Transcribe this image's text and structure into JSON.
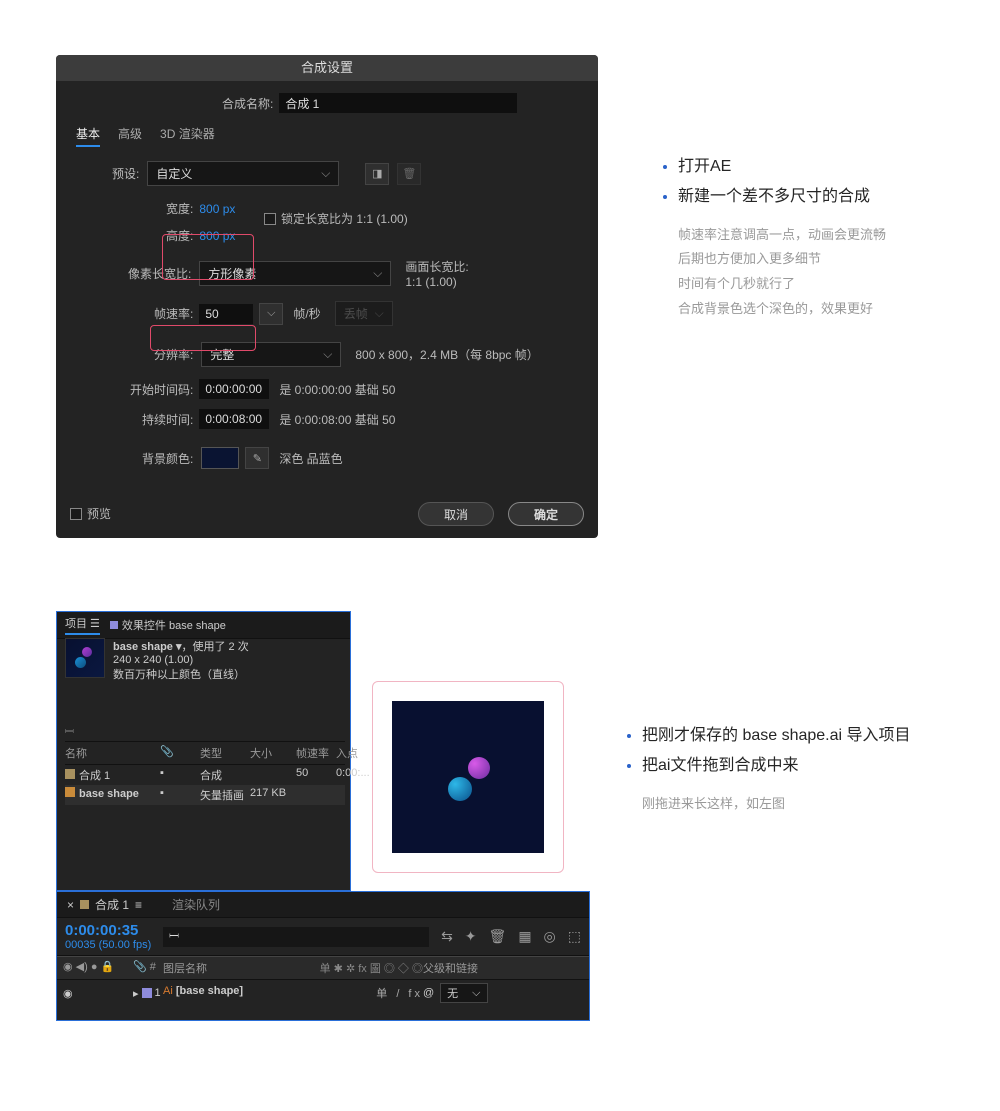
{
  "dialog": {
    "title": "合成设置",
    "comp_name_label": "合成名称:",
    "comp_name": "合成 1",
    "tabs": {
      "basic": "基本",
      "advanced": "高级",
      "renderer": "3D 渲染器"
    },
    "preset_label": "预设:",
    "preset_value": "自定义",
    "width_label": "宽度:",
    "width_value": "800 px",
    "height_label": "高度:",
    "height_value": "800 px",
    "lock_aspect": "锁定长宽比为 1:1 (1.00)",
    "par_label": "像素长宽比:",
    "par_value": "方形像素",
    "frame_ar_label": "画面长宽比:",
    "frame_ar_value": "1:1 (1.00)",
    "fps_label": "帧速率:",
    "fps_value": "50",
    "fps_unit": "帧/秒",
    "fps_dropframe": "丢帧",
    "res_label": "分辨率:",
    "res_value": "完整",
    "res_info": "800 x 800，2.4 MB（每 8bpc 帧）",
    "start_tc_label": "开始时间码:",
    "start_tc_value": "0:00:00:00",
    "start_tc_info": "是 0:00:00:00  基础 50",
    "dur_label": "持续时间:",
    "dur_value": "0:00:08:00",
    "dur_info": "是 0:00:08:00  基础 50",
    "bg_label": "背景颜色:",
    "bg_name": "深色 品蓝色",
    "preview_chk": "预览",
    "cancel": "取消",
    "ok": "确定"
  },
  "side1": {
    "b1": "打开AE",
    "b2": "新建一个差不多尺寸的合成",
    "n1": "帧速率注意调高一点，动画会更流畅",
    "n2": "后期也方便加入更多细节",
    "n3": "时间有个几秒就行了",
    "n4": "合成背景色选个深色的，效果更好"
  },
  "project": {
    "tab1": "项目",
    "tab2": "效果控件 base shape",
    "asset_name": "base shape ▾",
    "asset_used": "，使用了 2 次",
    "asset_size": "240 x 240 (1.00)",
    "asset_colors": "数百万种以上颜色（直线）",
    "col_name": "名称",
    "col_type": "类型",
    "col_size": "大小",
    "col_fps": "帧速率",
    "col_in": "入点",
    "row1_name": "合成 1",
    "row1_type": "合成",
    "row1_fps": "50",
    "row1_in": "0:00:...",
    "row2_name": "base shape",
    "row2_type": "矢量插画",
    "row2_size": "217 KB"
  },
  "side2": {
    "b1": "把刚才保存的 base shape.ai 导入项目",
    "b2": "把ai文件拖到合成中来",
    "n1": "刚拖进来长这样，如左图"
  },
  "timeline": {
    "tab1": "合成 1",
    "tab2": "渲染队列",
    "timecode": "0:00:00:35",
    "timesub": "00035 (50.00 fps)",
    "col_layer": "图层名称",
    "col_parent": "父级和链接",
    "switches_hdr": "单 ✱ ✲ fx 圖 ◎ ◇ ◎",
    "layer1_name": "[base shape]",
    "layer1_num": "1",
    "layer1_sw": "单    / fx",
    "parent_none": "无"
  }
}
